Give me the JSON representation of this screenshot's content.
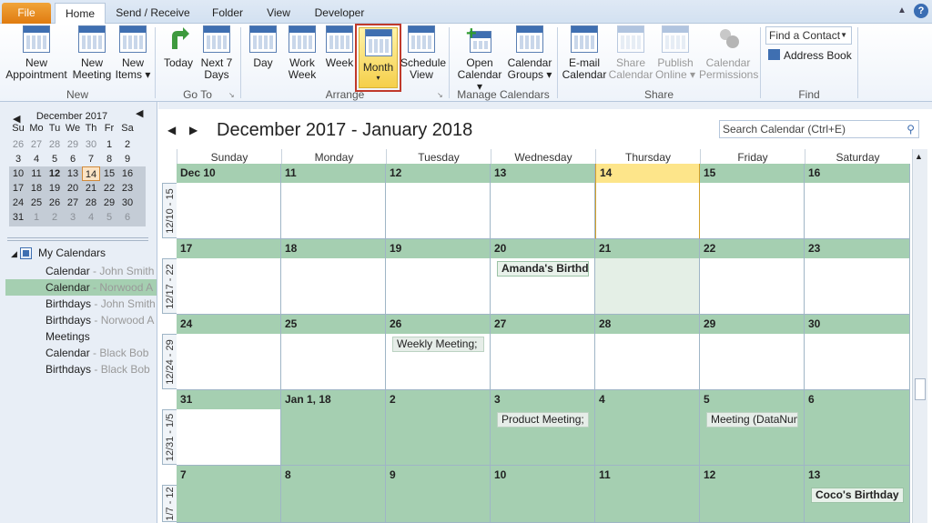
{
  "tabs": [
    "File",
    "Home",
    "Send / Receive",
    "Folder",
    "View",
    "Developer"
  ],
  "ribbon": {
    "new_group": "New",
    "goto_group": "Go To",
    "arrange_group": "Arrange",
    "manage_group": "Manage Calendars",
    "share_group": "Share",
    "find_group": "Find",
    "new_appointment": [
      "New",
      "Appointment"
    ],
    "new_meeting": [
      "New",
      "Meeting"
    ],
    "new_items": [
      "New",
      "Items ▾"
    ],
    "today": "Today",
    "next7": [
      "Next 7",
      "Days"
    ],
    "day": "Day",
    "work_week": [
      "Work",
      "Week"
    ],
    "week": "Week",
    "month": "Month",
    "month_arrow": "▾",
    "schedule_view": [
      "Schedule",
      "View"
    ],
    "open_calendar": [
      "Open",
      "Calendar ▾"
    ],
    "calendar_groups": [
      "Calendar",
      "Groups ▾"
    ],
    "email_calendar": [
      "E-mail",
      "Calendar"
    ],
    "share_calendar": [
      "Share",
      "Calendar"
    ],
    "publish_online": [
      "Publish",
      "Online ▾"
    ],
    "calendar_permissions": [
      "Calendar",
      "Permissions"
    ],
    "find_contact": "Find a Contact",
    "address_book": "Address Book"
  },
  "mini_cal": {
    "title": "December 2017",
    "weekdays": [
      "Su",
      "Mo",
      "Tu",
      "We",
      "Th",
      "Fr",
      "Sa"
    ],
    "weeks": [
      [
        "26",
        "27",
        "28",
        "29",
        "30",
        "1",
        "2"
      ],
      [
        "3",
        "4",
        "5",
        "6",
        "7",
        "8",
        "9"
      ],
      [
        "10",
        "11",
        "12",
        "13",
        "14",
        "15",
        "16"
      ],
      [
        "17",
        "18",
        "19",
        "20",
        "21",
        "22",
        "23"
      ],
      [
        "24",
        "25",
        "26",
        "27",
        "28",
        "29",
        "30"
      ],
      [
        "31",
        "1",
        "2",
        "3",
        "4",
        "5",
        "6"
      ]
    ]
  },
  "my_calendars": {
    "title": "My Calendars",
    "items": [
      {
        "name": "Calendar",
        "owner": "John Smith",
        "checked": false
      },
      {
        "name": "Calendar",
        "owner": "Norwood A",
        "checked": true
      },
      {
        "name": "Birthdays",
        "owner": "John Smith",
        "checked": false
      },
      {
        "name": "Birthdays",
        "owner": "Norwood A",
        "checked": false
      },
      {
        "name": "Meetings",
        "owner": "",
        "checked": false
      },
      {
        "name": "Calendar",
        "owner": "Black Bob",
        "checked": false
      },
      {
        "name": "Birthdays",
        "owner": "Black Bob",
        "checked": false
      }
    ]
  },
  "main": {
    "title": "December 2017 - January 2018",
    "search_placeholder": "Search Calendar (Ctrl+E)",
    "days": [
      "Sunday",
      "Monday",
      "Tuesday",
      "Wednesday",
      "Thursday",
      "Friday",
      "Saturday"
    ],
    "weeks": [
      {
        "label": "12/10 - 15",
        "dates": [
          "Dec 10",
          "11",
          "12",
          "13",
          "14",
          "15",
          "16"
        ]
      },
      {
        "label": "12/17 - 22",
        "dates": [
          "17",
          "18",
          "19",
          "20",
          "21",
          "22",
          "23"
        ]
      },
      {
        "label": "12/24 - 29",
        "dates": [
          "24",
          "25",
          "26",
          "27",
          "28",
          "29",
          "30"
        ]
      },
      {
        "label": "12/31 - 1/5",
        "dates": [
          "31",
          "Jan 1, 18",
          "2",
          "3",
          "4",
          "5",
          "6"
        ]
      },
      {
        "label": "1/7 - 12",
        "dates": [
          "7",
          "8",
          "9",
          "10",
          "11",
          "12",
          "13"
        ]
      }
    ],
    "events": [
      {
        "week": 1,
        "day": 3,
        "text": "Amanda's Birthday",
        "bold": true
      },
      {
        "week": 2,
        "day": 2,
        "text": "Weekly Meeting;",
        "bold": false
      },
      {
        "week": 3,
        "day": 3,
        "text": "Product Meeting;",
        "bold": false
      },
      {
        "week": 3,
        "day": 5,
        "text": "Meeting (DataNumen",
        "bold": false
      },
      {
        "week": 4,
        "day": 6,
        "text": "Coco's Birthday",
        "bold": true
      }
    ]
  },
  "colors": {
    "accent": "#3f6fb1",
    "cell_green": "#a5cfb1",
    "today": "#fde58a",
    "month_highlight": "#fde27a"
  }
}
